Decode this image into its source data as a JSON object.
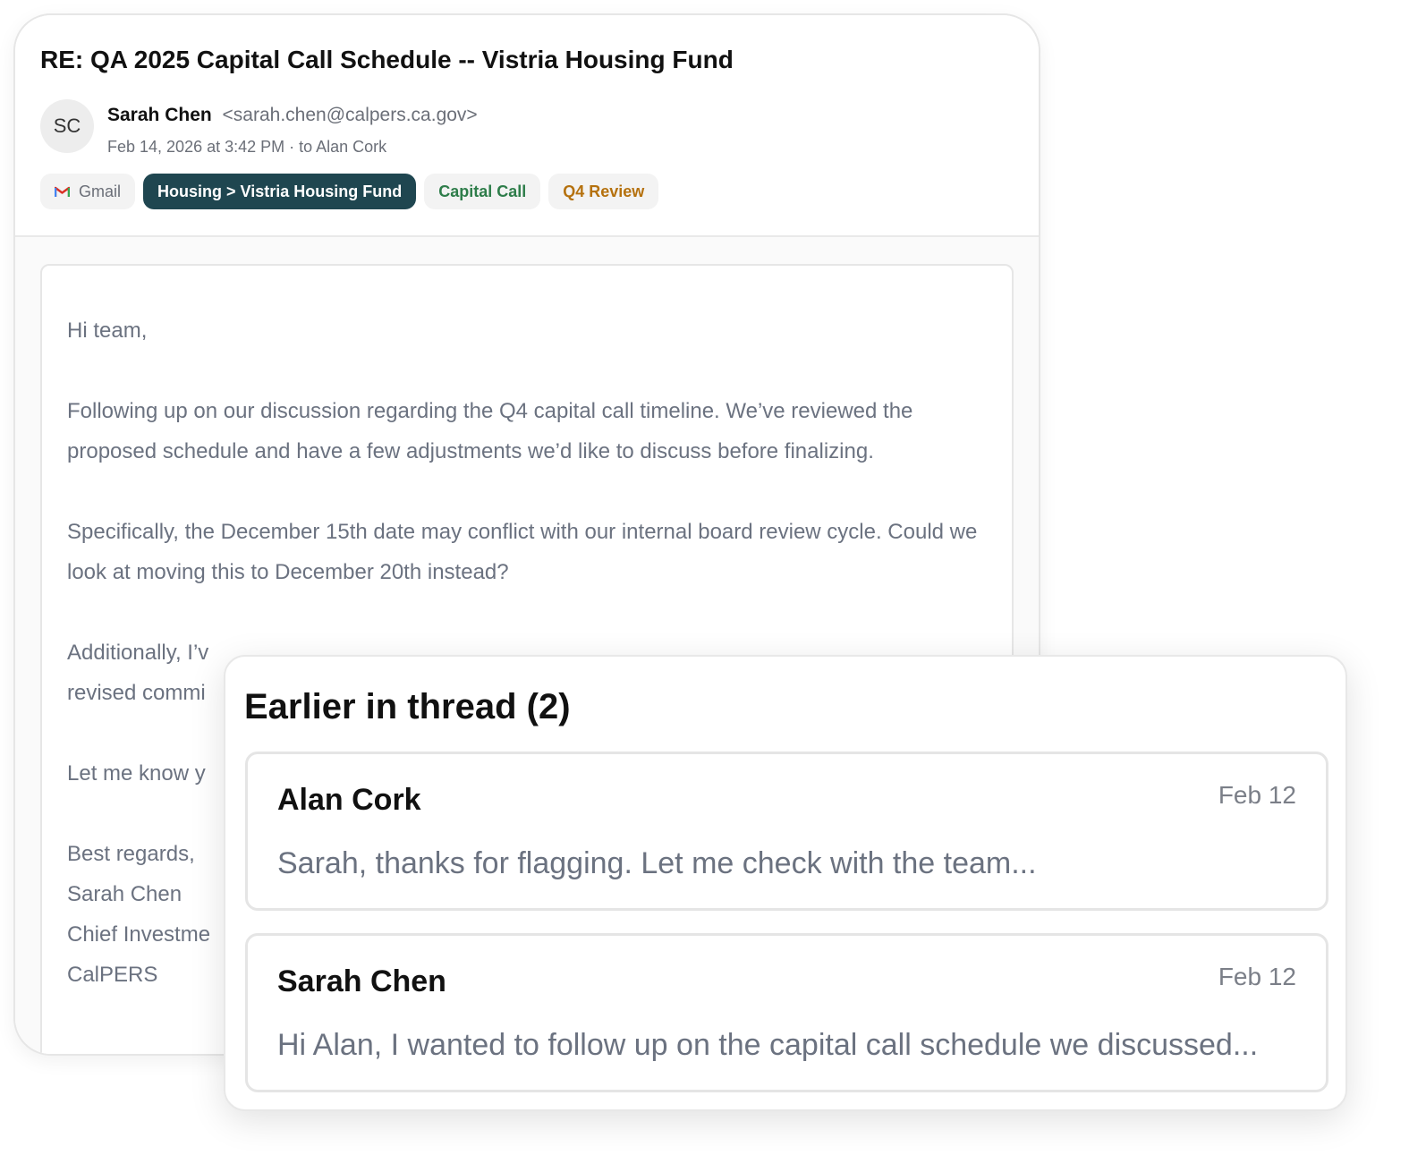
{
  "email": {
    "subject": "RE: QA 2025 Capital Call Schedule -- Vistria Housing Fund",
    "sender": {
      "initials": "SC",
      "name": "Sarah Chen",
      "email": "<sarah.chen@calpers.ca.gov>",
      "meta": "Feb 14, 2026 at 3:42 PM · to Alan Cork"
    },
    "labels": [
      {
        "text": "Gmail",
        "icon": "gmail-icon"
      },
      {
        "text": "Housing > Vistria Housing Fund",
        "color": "#1f4650"
      },
      {
        "text": "Capital Call",
        "color": "#2e7d4a"
      },
      {
        "text": "Q4 Review",
        "color": "#b5710e"
      }
    ],
    "body": {
      "greeting": "Hi team,",
      "paragraph1": "Following up on our discussion regarding the Q4 capital call timeline. We’ve reviewed the proposed schedule and have a few adjustments we’d like to discuss before finalizing.",
      "paragraph2": "Specifically, the December 15th date may conflict with our internal board review cycle. Could we look at moving this to December 20th instead?",
      "paragraph3": "Additionally, I’v",
      "paragraph3_line2": "revised commi",
      "paragraph4": "Let me know y",
      "signature": [
        "Best regards,",
        "Sarah Chen",
        "Chief Investme",
        "CalPERS"
      ]
    }
  },
  "thread": {
    "title": "Earlier in thread (2)",
    "items": [
      {
        "name": "Alan Cork",
        "date": "Feb 12",
        "preview": "Sarah, thanks for flagging. Let me check with the team..."
      },
      {
        "name": "Sarah Chen",
        "date": "Feb 12",
        "preview": "Hi Alan, I wanted to follow up on the capital call schedule we discussed..."
      }
    ]
  }
}
